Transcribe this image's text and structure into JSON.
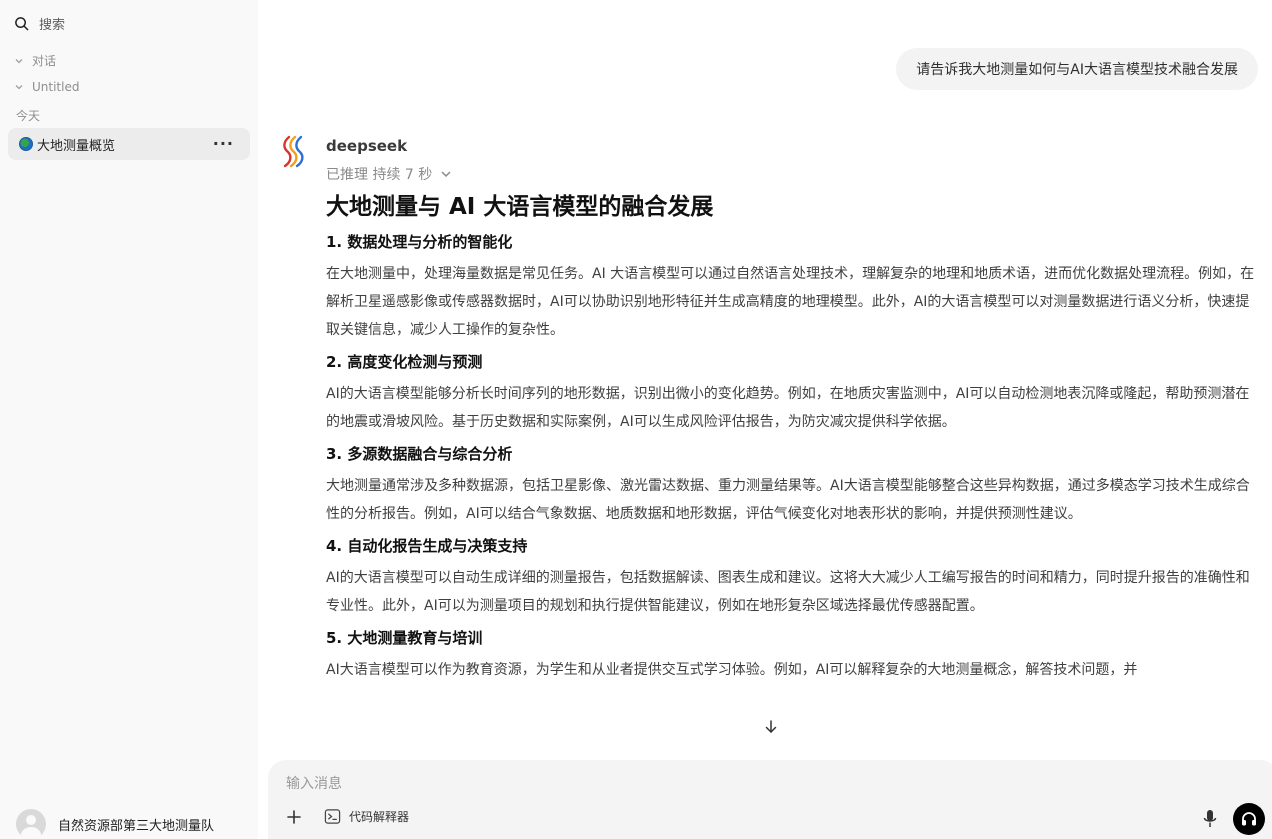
{
  "sidebar": {
    "search_label": "搜索",
    "groups": [
      {
        "label": "对话"
      },
      {
        "label": "Untitled"
      }
    ],
    "today_label": "今天",
    "active_conversation": {
      "title": "大地测量概览",
      "more": "···"
    },
    "user": {
      "name": "自然资源部第三大地测量队"
    }
  },
  "chat": {
    "user_message": "请告诉我大地测量如何与AI大语言模型技术融合发展",
    "assistant": {
      "name": "deepseek",
      "reasoning_status": "已推理 持续 7 秒",
      "title": "大地测量与 AI 大语言模型的融合发展",
      "sections": [
        {
          "heading": "1. 数据处理与分析的智能化",
          "body": "在大地测量中，处理海量数据是常见任务。AI 大语言模型可以通过自然语言处理技术，理解复杂的地理和地质术语，进而优化数据处理流程。例如，在解析卫星遥感影像或传感器数据时，AI可以协助识别地形特征并生成高精度的地理模型。此外，AI的大语言模型可以对测量数据进行语义分析，快速提取关键信息，减少人工操作的复杂性。"
        },
        {
          "heading": "2. 高度变化检测与预测",
          "body": "AI的大语言模型能够分析长时间序列的地形数据，识别出微小的变化趋势。例如，在地质灾害监测中，AI可以自动检测地表沉降或隆起，帮助预测潜在的地震或滑坡风险。基于历史数据和实际案例，AI可以生成风险评估报告，为防灾减灾提供科学依据。"
        },
        {
          "heading": "3. 多源数据融合与综合分析",
          "body": "大地测量通常涉及多种数据源，包括卫星影像、激光雷达数据、重力测量结果等。AI大语言模型能够整合这些异构数据，通过多模态学习技术生成综合性的分析报告。例如，AI可以结合气象数据、地质数据和地形数据，评估气候变化对地表形状的影响，并提供预测性建议。"
        },
        {
          "heading": "4. 自动化报告生成与决策支持",
          "body": "AI的大语言模型可以自动生成详细的测量报告，包括数据解读、图表生成和建议。这将大大减少人工编写报告的时间和精力，同时提升报告的准确性和专业性。此外，AI可以为测量项目的规划和执行提供智能建议，例如在地形复杂区域选择最优传感器配置。"
        },
        {
          "heading": "5. 大地测量教育与培训",
          "body": "AI大语言模型可以作为教育资源，为学生和从业者提供交互式学习体验。例如，AI可以解释复杂的大地测量概念，解答技术问题，并"
        }
      ]
    }
  },
  "composer": {
    "placeholder": "输入消息",
    "tool_label": "代码解释器"
  }
}
